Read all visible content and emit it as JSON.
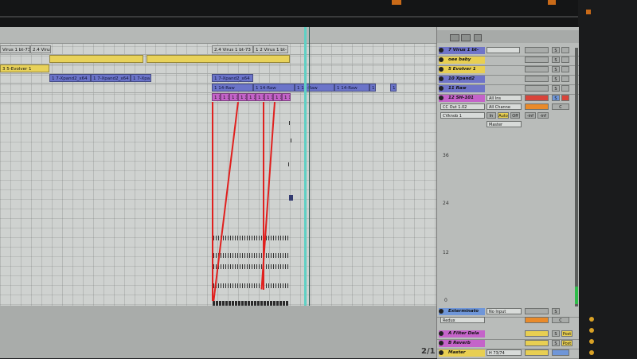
{
  "arrangement": {
    "locator_labels": [
      "Virus 1 bt-73",
      "2.4 Virus",
      "2.4 Virus 1 bt-73",
      "1 2 Virus 1 bt-"
    ],
    "yellow_clips": [
      "",
      "3 5-Evolver 1",
      "3 5-Evolver 1"
    ],
    "blue_clips": [
      "1 7-Xpand2_x64",
      "1 7-Xpand2_x64",
      "1 7-Xpa",
      "1 7-Xpand2_x64"
    ],
    "raw_clips": [
      "1 14-Raw",
      "1 14-Raw",
      "1 14-Raw",
      "1 14-Raw",
      "1",
      "1"
    ],
    "magenta_clips": [
      "1 1",
      "1 1",
      "1 1",
      "1 1",
      "1 1",
      "1 1",
      "1 1",
      "1 1",
      "1 1"
    ],
    "page_indicator": "2/1"
  },
  "mixer": {
    "tracks": [
      {
        "name": "7 Virus 1 bt-",
        "color": "#6f74c8"
      },
      {
        "name": "oee baby",
        "color": "#e8cf52"
      },
      {
        "name": "5 Evolver 1",
        "color": "#e8cf52"
      },
      {
        "name": "10 Xpand2",
        "color": "#6f74c8"
      },
      {
        "name": "11 Raw",
        "color": "#6f74c8"
      },
      {
        "name": "12 SH-101",
        "color": "#c463c9"
      }
    ],
    "sh101_routing": {
      "midi_from": "All Ins",
      "channel": "All Channe",
      "midi_to": "CC Out 1.02",
      "midi_to_channel": "CVknob 1",
      "monitor": [
        "In",
        "Auto",
        "Off"
      ],
      "output": "Master",
      "vol_1": "-inf",
      "vol_2": "-inf"
    },
    "scale_labels": [
      "36",
      "24",
      "12",
      "0"
    ],
    "return_tracks": [
      {
        "name": "Exterminato",
        "input": "No Input",
        "device": "Redux",
        "color": "#6f96d8"
      },
      {
        "name": "A Filter Dela",
        "color": "#c463c9"
      },
      {
        "name": "B Reverb",
        "color": "#c463c9"
      },
      {
        "name": "Master",
        "color": "#e8cf52",
        "tempo_sig": "H 73/74"
      }
    ],
    "button_labels": {
      "solo": "S",
      "cue": "C",
      "post": "Post"
    }
  }
}
